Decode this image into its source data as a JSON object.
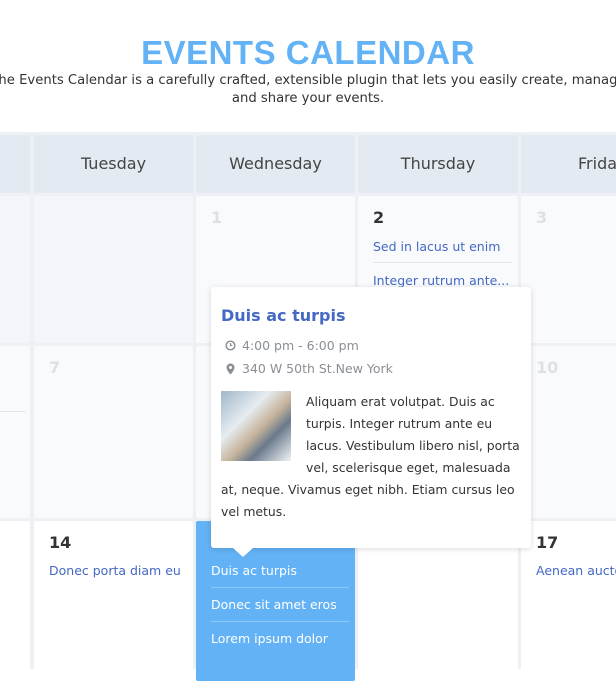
{
  "header": {
    "title": "EVENTS CALENDAR",
    "subtitle": "The Events Calendar is a carefully crafted, extensible plugin that lets you easily create, manage and share your events."
  },
  "days": [
    "Tuesday",
    "Wednesday",
    "Thursday",
    "Frida"
  ],
  "cells": {
    "d1": "1",
    "d2": "2",
    "d3": "3",
    "d7": "7",
    "d10": "10",
    "d14": "14",
    "d17": "17",
    "d2_events": [
      "Sed in lacus ut enim",
      "Integer rutrum ante..."
    ],
    "d14_events": [
      "Donec porta diam eu"
    ],
    "d15_events": [
      "Duis ac turpis",
      "Donec sit amet eros",
      "Lorem ipsum dolor"
    ],
    "d17_events": [
      "Aenean aucto"
    ]
  },
  "popup": {
    "title": "Duis ac turpis",
    "time": "4:00 pm - 6:00 pm",
    "location": "340 W 50th St.New York",
    "description": "Aliquam erat volutpat. Duis ac turpis. Integer rutrum ante eu lacus. Vestibulum libero nisl, porta vel, scelerisque eget, malesuada at, neque. Vivamus eget nibh. Etiam cursus leo vel metus.",
    "icons": [
      "clock-icon",
      "map-marker-icon"
    ]
  },
  "colors": {
    "accent": "#62b2f5",
    "link": "#4468c4"
  }
}
